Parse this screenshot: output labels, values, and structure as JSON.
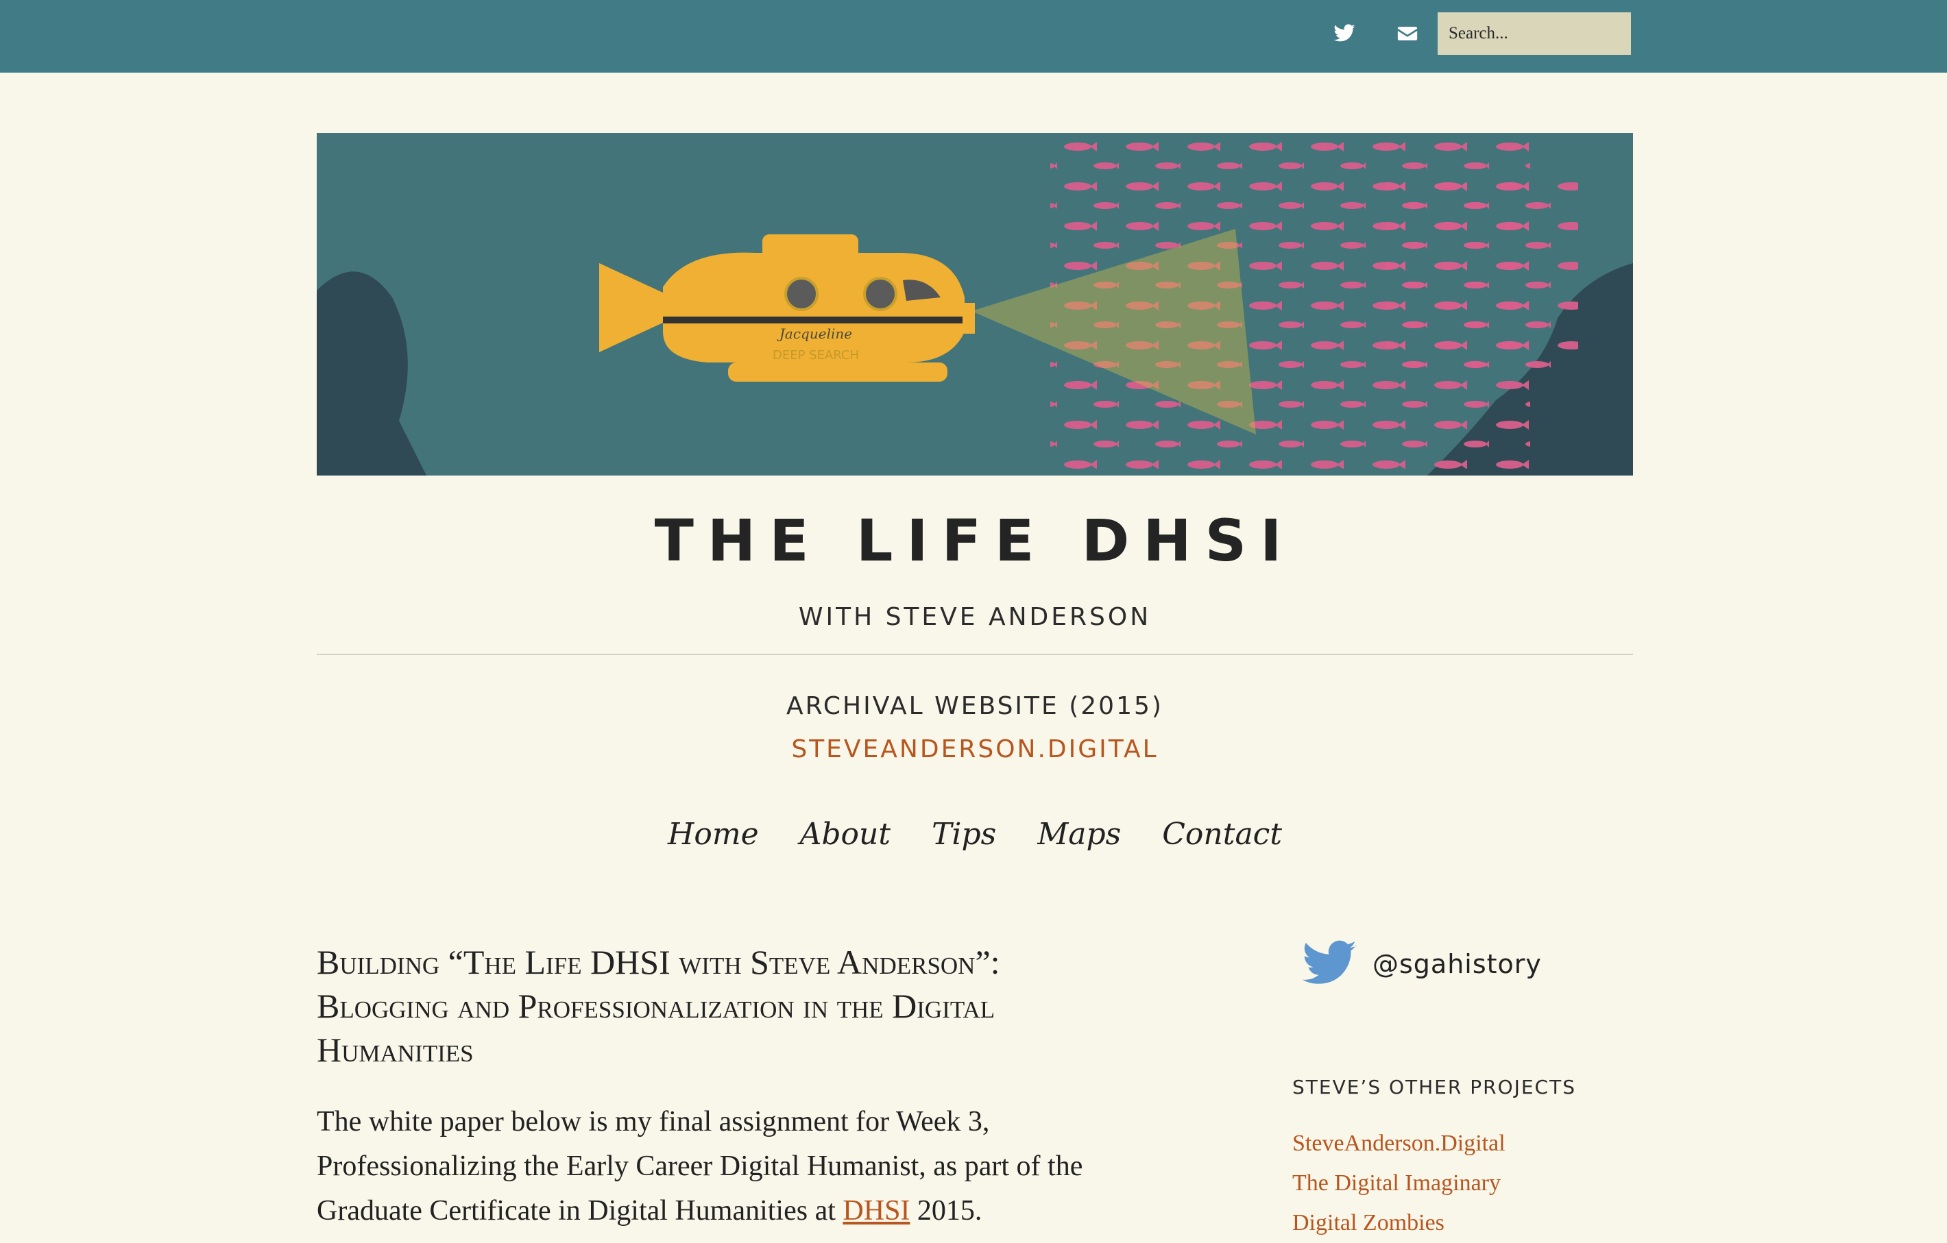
{
  "topbar": {
    "search_placeholder": "Search..."
  },
  "icons": {
    "twitter": "twitter-icon",
    "mail": "envelope-icon"
  },
  "banner": {
    "sub_name": "Jacqueline",
    "sub_tag": "DEEP SEARCH"
  },
  "site": {
    "title": "THE LIFE DHSI",
    "subtitle": "WITH STEVE ANDERSON",
    "archive_label": "ARCHIVAL WEBSITE (2015)",
    "archive_link": "STEVEANDERSON.DIGITAL"
  },
  "nav": {
    "items": [
      "Home",
      "About",
      "Tips",
      "Maps",
      "Contact"
    ]
  },
  "post": {
    "title": "Building “The Life DHSI with Steve Anderson”: Blogging and Professionalization in the Digital Humanities",
    "body_before": "The white paper below is my final assignment for Week 3, Professionalizing the Early Career Digital Humanist, as part of the Graduate Certificate in Digital Humanities at ",
    "body_link": "DHSI",
    "body_after": " 2015."
  },
  "sidebar": {
    "twitter_handle": "@sgahistory",
    "projects_heading": "STEVE’S OTHER PROJECTS",
    "projects": [
      "SteveAnderson.Digital",
      "The Digital Imaginary",
      "Digital Zombies"
    ]
  },
  "colors": {
    "topbar": "#417b86",
    "background": "#f9f7ea",
    "accent": "#b7561f",
    "search_bg": "#d9d6b9",
    "twitter_blue": "#5e97d0"
  }
}
